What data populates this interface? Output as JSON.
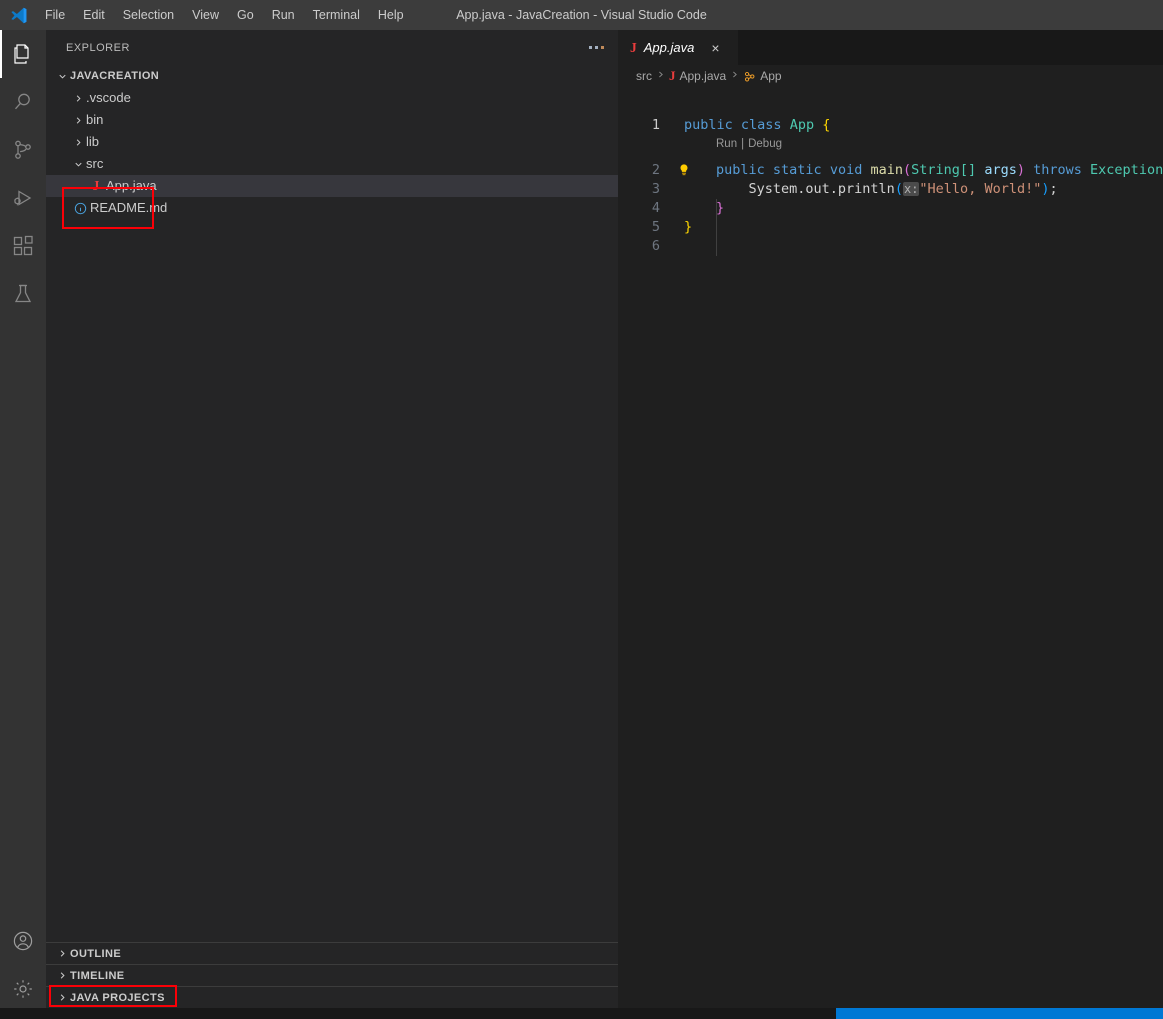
{
  "window": {
    "title": "App.java - JavaCreation - Visual Studio Code",
    "logo_icon": "vscode-logo-icon"
  },
  "menubar": {
    "items": [
      {
        "label": "File"
      },
      {
        "label": "Edit"
      },
      {
        "label": "Selection"
      },
      {
        "label": "View"
      },
      {
        "label": "Go"
      },
      {
        "label": "Run"
      },
      {
        "label": "Terminal"
      },
      {
        "label": "Help"
      }
    ]
  },
  "activity_bar": {
    "items": [
      {
        "name": "explorer",
        "icon": "files-icon",
        "active": true
      },
      {
        "name": "search",
        "icon": "search-icon",
        "active": false
      },
      {
        "name": "source-control",
        "icon": "source-control-icon",
        "active": false
      },
      {
        "name": "run-and-debug",
        "icon": "run-debug-icon",
        "active": false
      },
      {
        "name": "extensions",
        "icon": "extensions-icon",
        "active": false
      },
      {
        "name": "testing",
        "icon": "testing-beaker-icon",
        "active": false
      }
    ],
    "bottom_items": [
      {
        "name": "accounts",
        "icon": "account-circle-icon"
      },
      {
        "name": "manage-settings",
        "icon": "gear-icon"
      }
    ]
  },
  "sidebar": {
    "header_title": "EXPLORER",
    "more_actions_label": "...",
    "tree": {
      "root": {
        "label": "JAVACREATION",
        "expanded": true
      },
      "children": [
        {
          "label": ".vscode",
          "type": "folder",
          "expanded": false,
          "indent": 1
        },
        {
          "label": "bin",
          "type": "folder",
          "expanded": false,
          "indent": 1
        },
        {
          "label": "lib",
          "type": "folder",
          "expanded": false,
          "indent": 1
        },
        {
          "label": "src",
          "type": "folder",
          "expanded": true,
          "indent": 1
        },
        {
          "label": "App.java",
          "type": "java-file",
          "icon": "java-file-icon",
          "indent": 2,
          "selected": true
        },
        {
          "label": "README.md",
          "type": "markdown-file",
          "icon": "markdown-info-icon",
          "indent": 1
        }
      ]
    },
    "bottom_panels": [
      {
        "label": "OUTLINE",
        "expanded": false
      },
      {
        "label": "TIMELINE",
        "expanded": false
      },
      {
        "label": "JAVA PROJECTS",
        "expanded": false,
        "highlighted": true
      }
    ]
  },
  "annotations": {
    "color": "#fb0007",
    "boxes": [
      {
        "target": "src-and-appjava-tree-rows"
      },
      {
        "target": "java-projects-panel"
      }
    ]
  },
  "editor": {
    "tab": {
      "label": "App.java",
      "icon": "java-file-icon",
      "close_label": "×",
      "preview_italic": true,
      "active": true
    },
    "breadcrumbs": [
      {
        "label": "src",
        "icon": ""
      },
      {
        "label": "App.java",
        "icon": "java-file-icon"
      },
      {
        "label": "App",
        "icon": "class-symbol-icon"
      }
    ],
    "separator": "❯",
    "codelens": {
      "run": "Run",
      "divider": "|",
      "debug": "Debug"
    },
    "lightbulb_icon": "lightbulb-icon",
    "gutter_lines": [
      "1",
      "2",
      "3",
      "4",
      "5",
      "6"
    ],
    "current_line": 1,
    "inlay_hint": "x:",
    "code": {
      "line1": {
        "kw1": "public",
        "kw2": "class",
        "cls": "App",
        "brace": "{"
      },
      "line2": {
        "kw1": "public",
        "kw2": "static",
        "kw3": "void",
        "fn": "main",
        "open": "(",
        "type": "String[]",
        "arg": "args",
        "close": ")",
        "kw4": "throws",
        "exc": "Exception",
        "brace": "{"
      },
      "line3": {
        "expr": "System.out.println",
        "open": "(",
        "hint": "x:",
        "str": "\"Hello, World!\"",
        "close": ")",
        "semi": ";"
      },
      "line4": {
        "brace": "}"
      },
      "line5": {
        "brace": "}"
      },
      "line6": {
        "text": ""
      }
    },
    "theme_colors": {
      "editor_bg": "#1f1f1f",
      "sidebar_bg": "#252526",
      "titlebar_bg": "#3c3c3c",
      "activitybar_bg": "#333333",
      "selection_bg": "#37373d",
      "keyword": "#569cd6",
      "control_keyword": "#c586c0",
      "class_name": "#4ec9b0",
      "function": "#dcdcaa",
      "string": "#ce9178",
      "variable": "#9cdcfe",
      "bracket_yellow": "#ffd700",
      "bracket_pink": "#da70d6",
      "java_red": "#ea3d3d",
      "status_accent": "#0078d4"
    }
  },
  "statusbar": {
    "accent": "#0078d4"
  }
}
